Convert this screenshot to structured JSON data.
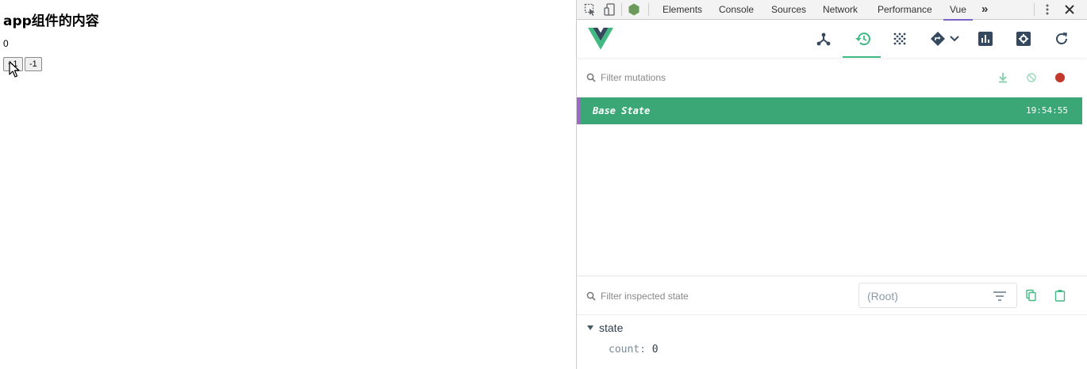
{
  "page": {
    "heading": "app组件的内容",
    "count_value": "0",
    "increment_label": "+1",
    "decrement_label": "-1"
  },
  "devtools": {
    "tabs": [
      "Elements",
      "Console",
      "Sources",
      "Network",
      "Performance",
      "Vue"
    ],
    "active_tab": "Vue",
    "more_tabs_symbol": "»",
    "vue": {
      "tools": [
        "components-icon",
        "vuex-history-icon",
        "events-icon",
        "routing-icon",
        "performance-icon",
        "settings-icon",
        "refresh-icon"
      ],
      "active_tool": "vuex-history-icon",
      "mutations_filter_placeholder": "Filter mutations",
      "mutation": {
        "name": "Base State",
        "time": "19:54:55"
      },
      "state_filter_placeholder": "Filter inspected state",
      "root_select_value": "(Root)",
      "state_tree": {
        "section": "state",
        "prop_key": "count",
        "prop_value": "0"
      }
    },
    "colors": {
      "accent": "#42b983",
      "mutation_row": "#3ba776",
      "tab_underline": "#7b65c7",
      "record": "#c0392b"
    }
  }
}
